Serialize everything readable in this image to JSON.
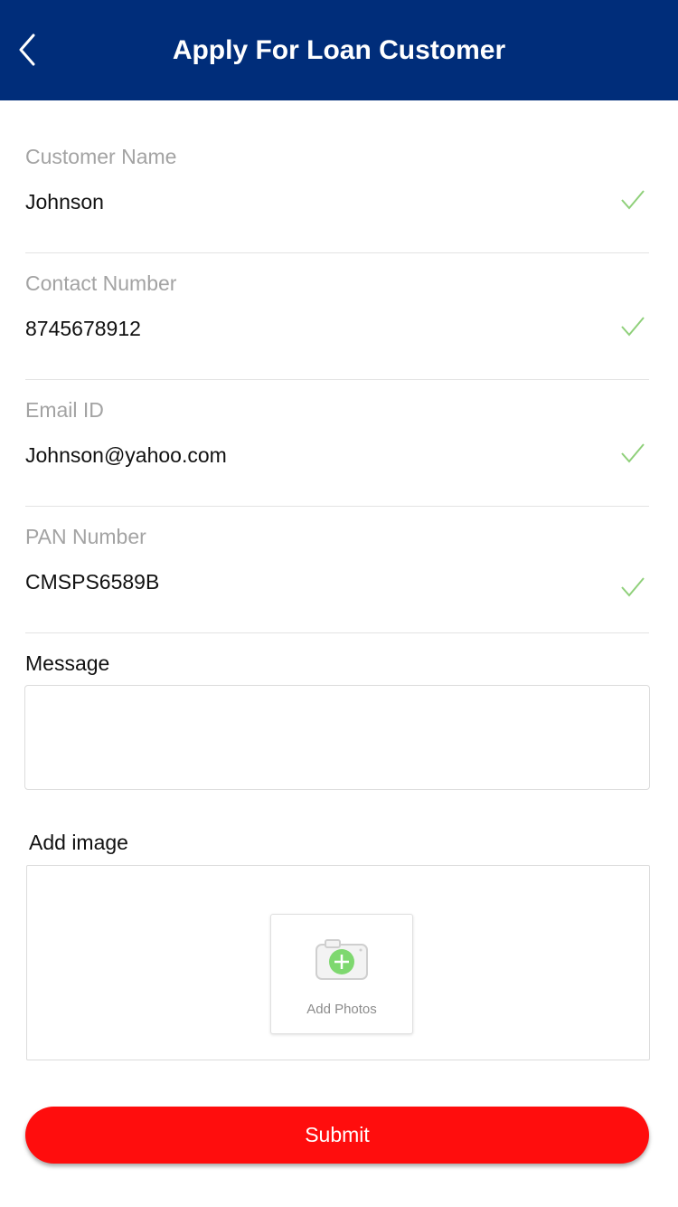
{
  "header": {
    "title": "Apply For Loan Customer",
    "back_icon": "chevron-left-icon"
  },
  "form": {
    "fields": [
      {
        "label": "Customer Name",
        "value": "Johnson",
        "valid": true
      },
      {
        "label": "Contact Number",
        "value": "8745678912",
        "valid": true
      },
      {
        "label": "Email ID",
        "value": "Johnson@yahoo.com",
        "valid": true
      },
      {
        "label": "PAN Number",
        "value": "CMSPS6589B",
        "valid": true
      }
    ],
    "message": {
      "label": "Message",
      "value": ""
    },
    "image": {
      "label": "Add image",
      "add_photos_label": "Add Photos",
      "icon": "camera-add-icon"
    },
    "submit_label": "Submit"
  },
  "colors": {
    "header_bg": "#002d7a",
    "check": "#8fd07a",
    "submit_bg": "#ff0d0d",
    "camera_plus": "#7ed86f"
  }
}
